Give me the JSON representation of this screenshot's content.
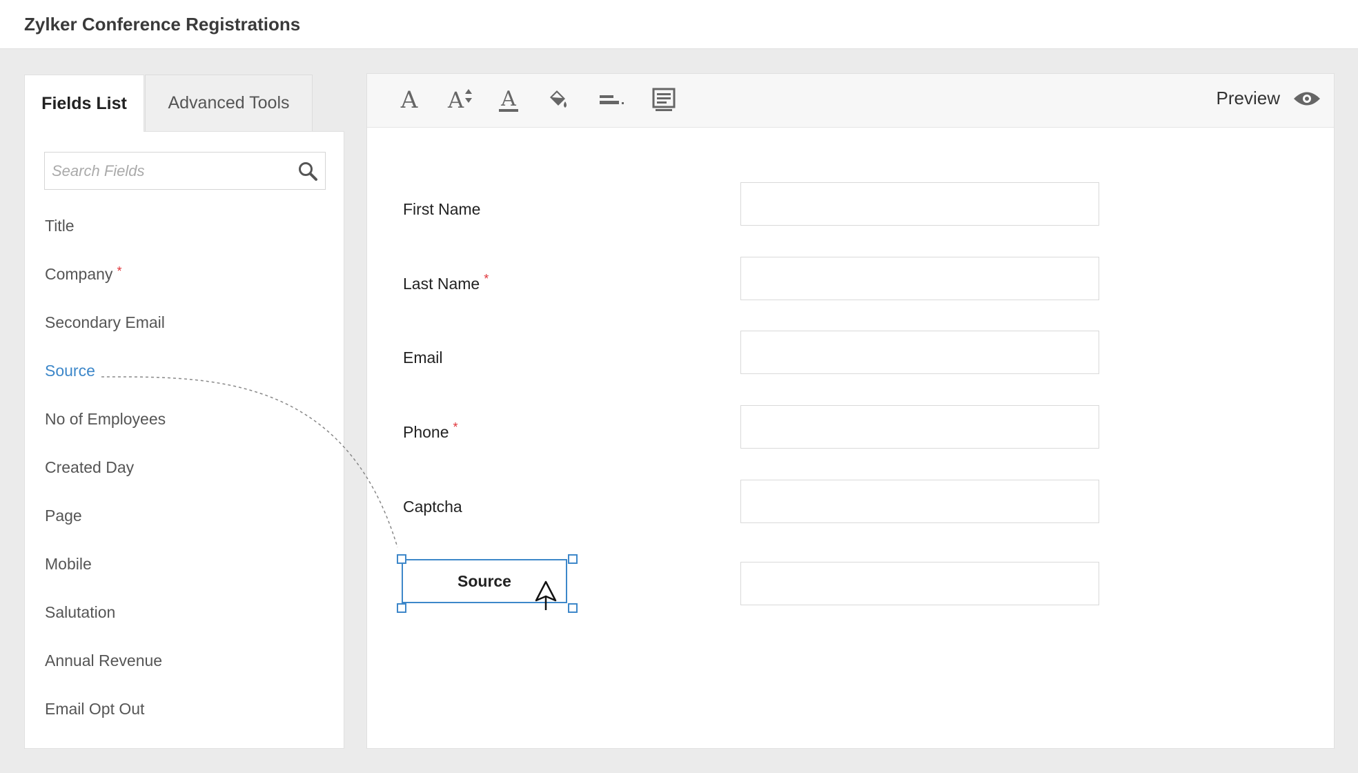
{
  "app": {
    "title": "Zylker Conference Registrations"
  },
  "tabs": [
    {
      "label": "Fields List",
      "active": true
    },
    {
      "label": "Advanced Tools",
      "active": false
    }
  ],
  "search": {
    "placeholder": "Search Fields",
    "value": ""
  },
  "fields": [
    {
      "label": "Title",
      "required": false,
      "active": false
    },
    {
      "label": "Company",
      "required": true,
      "active": false
    },
    {
      "label": "Secondary Email",
      "required": false,
      "active": false
    },
    {
      "label": "Source",
      "required": false,
      "active": true
    },
    {
      "label": "No of Employees",
      "required": false,
      "active": false
    },
    {
      "label": "Created Day",
      "required": false,
      "active": false
    },
    {
      "label": "Page",
      "required": false,
      "active": false
    },
    {
      "label": "Mobile",
      "required": false,
      "active": false
    },
    {
      "label": "Salutation",
      "required": false,
      "active": false
    },
    {
      "label": "Annual Revenue",
      "required": false,
      "active": false
    },
    {
      "label": "Email Opt Out",
      "required": false,
      "active": false
    }
  ],
  "toolbar": {
    "tools": [
      "font-style-icon",
      "font-size-icon",
      "font-color-icon",
      "fill-color-icon",
      "label-align-icon",
      "layout-icon"
    ],
    "preview_label": "Preview"
  },
  "form": {
    "fields": [
      {
        "label": "First Name",
        "required": false
      },
      {
        "label": "Last Name",
        "required": true
      },
      {
        "label": "Email",
        "required": false
      },
      {
        "label": "Phone",
        "required": true
      },
      {
        "label": "Captcha",
        "required": false
      }
    ],
    "dragging_field": {
      "label": "Source"
    }
  },
  "required_marker": "*",
  "colors": {
    "accent": "#3d87c9",
    "required": "#e0353b",
    "background": "#ebebeb"
  }
}
